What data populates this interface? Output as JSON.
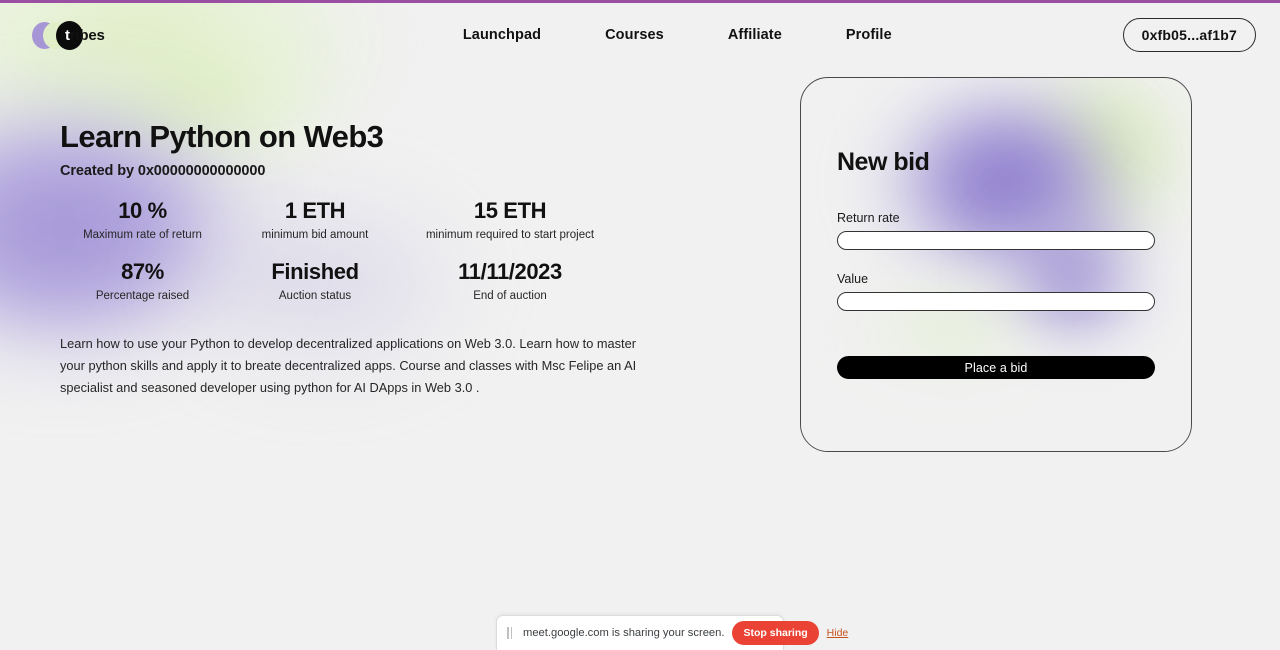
{
  "brand": {
    "name": "tribes",
    "name_head": "t",
    "name_tail": "ribes",
    "accent_purple": "#a796d6",
    "accent_green": "#e0efc8",
    "accent_black": "#0b0b0b",
    "top_border_color": "#9b4fa3"
  },
  "header": {
    "nav": [
      {
        "label": "Launchpad",
        "name": "launchpad"
      },
      {
        "label": "Courses",
        "name": "courses"
      },
      {
        "label": "Affiliate",
        "name": "affiliate"
      },
      {
        "label": "Profile",
        "name": "profile"
      }
    ],
    "wallet": "0xfb05...af1b7"
  },
  "project": {
    "title": "Learn Python on Web3",
    "created_by": "Created by 0x00000000000000",
    "description": "Learn how to use your Python to develop decentralized applications on Web 3.0. Learn how to master your python skills and apply it to breate decentralized apps. Course and classes with Msc Felipe an AI specialist and seasoned developer using python for AI DApps in Web 3.0 .",
    "stats": [
      {
        "value": "10 %",
        "label": "Maximum rate of return"
      },
      {
        "value": "1 ETH",
        "label": "minimum bid amount"
      },
      {
        "value": "15 ETH",
        "label": "minimum required to start project"
      },
      {
        "value": "87%",
        "label": "Percentage raised"
      },
      {
        "value": "Finished",
        "label": "Auction status"
      },
      {
        "value": "11/11/2023",
        "label": "End of auction"
      }
    ]
  },
  "bid_card": {
    "title": "New bid",
    "return_rate": {
      "label": "Return rate",
      "value": "",
      "placeholder": ""
    },
    "value_field": {
      "label": "Value",
      "value": "",
      "placeholder": ""
    },
    "submit_label": "Place a bid",
    "submit_bg": "#000000"
  },
  "share_bar": {
    "message": "meet.google.com is sharing your screen.",
    "stop_label": "Stop sharing",
    "hide_label": "Hide",
    "stop_color": "#ea4335"
  }
}
